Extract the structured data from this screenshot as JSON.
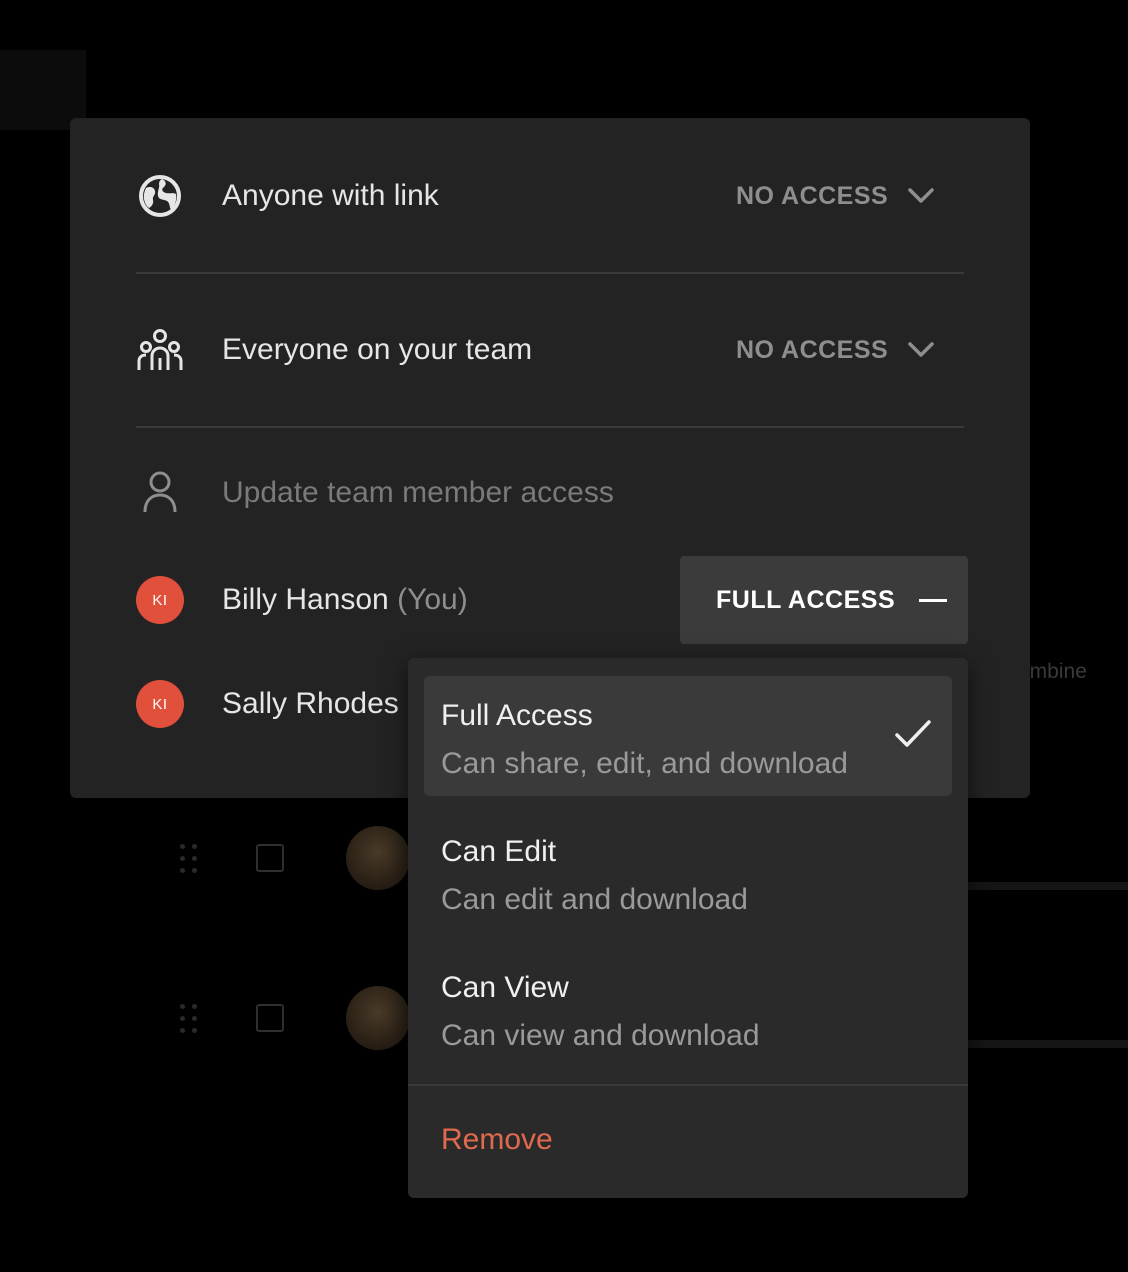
{
  "background": {
    "partial_text": "ombine"
  },
  "sharing": {
    "link_row": {
      "label": "Anyone with link",
      "access": "NO ACCESS",
      "icon": "globe-icon"
    },
    "team_row": {
      "label": "Everyone on your team",
      "access": "NO ACCESS",
      "icon": "team-icon"
    },
    "search": {
      "placeholder": "Update team member access",
      "icon": "person-icon"
    },
    "members": [
      {
        "initials": "KI",
        "name": "Billy Hanson",
        "suffix": "(You)",
        "access": "FULL ACCESS"
      },
      {
        "initials": "KI",
        "name": "Sally Rhodes"
      }
    ]
  },
  "access_menu": {
    "options": [
      {
        "title": "Full Access",
        "description": "Can share, edit, and download",
        "selected": true
      },
      {
        "title": "Can Edit",
        "description": "Can edit and download",
        "selected": false
      },
      {
        "title": "Can View",
        "description": "Can view and download",
        "selected": false
      }
    ],
    "remove_label": "Remove"
  },
  "colors": {
    "page_background": "#000000",
    "panel_background": "#232323",
    "menu_background": "#2a2a2a",
    "selected_option": "#3a3a3a",
    "avatar": "#e0503a",
    "remove_text": "#e0694e",
    "muted_text": "#8e8e8e"
  }
}
